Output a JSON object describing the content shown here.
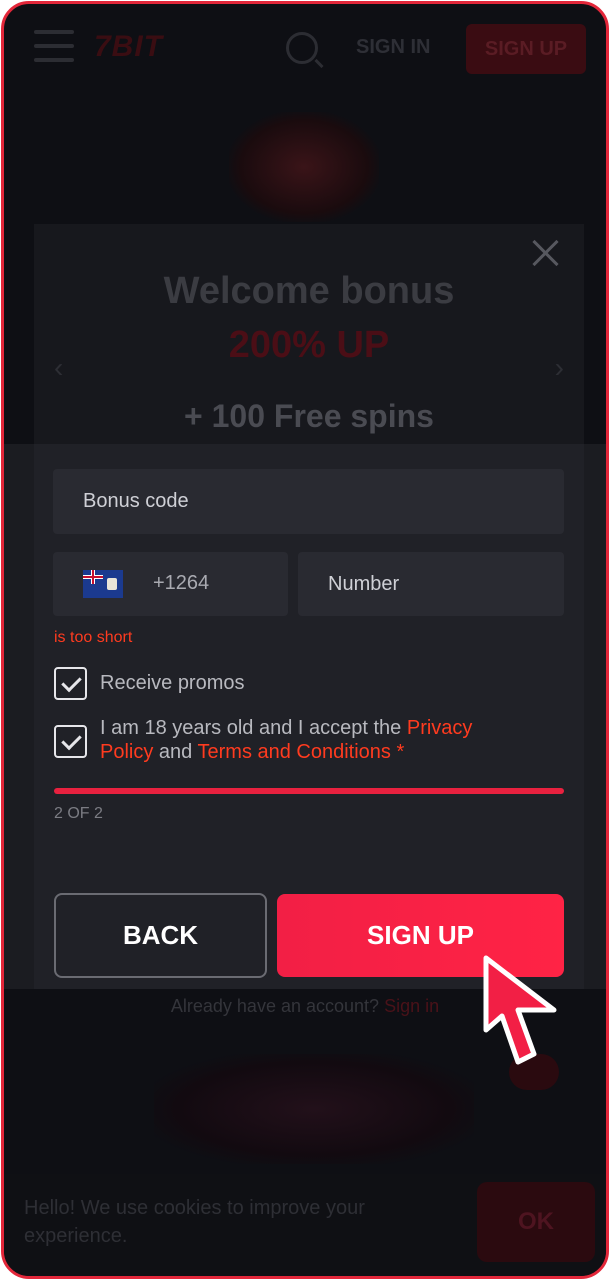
{
  "header": {
    "logo": "7BIT",
    "sign_in": "SIGN IN",
    "sign_up": "SIGN UP"
  },
  "promo": {
    "title": "Welcome bonus",
    "highlight": "200% UP",
    "subtitle": "+ 100 Free spins"
  },
  "form": {
    "bonus_placeholder": "Bonus code",
    "country_prefix": "+1264",
    "number_placeholder": "Number",
    "error": "is too short",
    "receive_promos": "Receive promos",
    "terms_prefix": "I am 18 years old and I accept the",
    "privacy_link": "Privacy Policy",
    "and": "and",
    "terms_link": "Terms and Conditions",
    "required_mark": "*",
    "step": "2 OF 2",
    "back": "BACK",
    "sign_up": "SIGN UP"
  },
  "footer": {
    "already_text": "Already have an account?",
    "sign_in_link": "Sign in"
  },
  "cookie": {
    "text": "Hello! We use cookies to improve your experience.",
    "ok": "OK"
  },
  "colors": {
    "accent": "#f21f45",
    "error": "#ff3b1f",
    "frame": "#e3273a"
  }
}
